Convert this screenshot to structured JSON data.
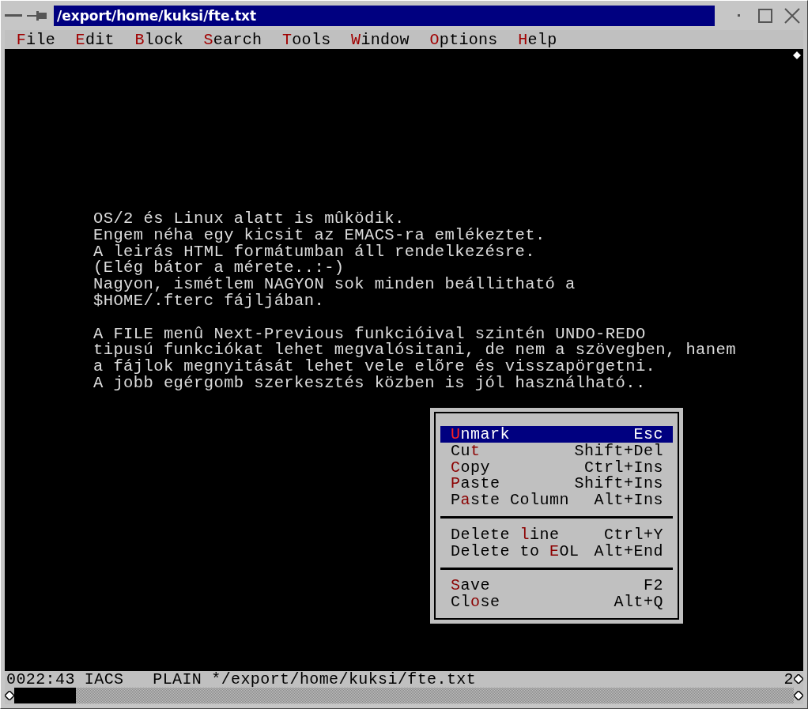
{
  "window": {
    "title": "/export/home/kuksi/fte.txt"
  },
  "menu_bar": [
    {
      "hotkey": "F",
      "after": "ile"
    },
    {
      "hotkey": "E",
      "after": "dit"
    },
    {
      "hotkey": "B",
      "after": "lock"
    },
    {
      "hotkey": "S",
      "after": "earch"
    },
    {
      "hotkey": "T",
      "after": "ools"
    },
    {
      "hotkey": "W",
      "after": "indow"
    },
    {
      "hotkey": "O",
      "after": "ptions"
    },
    {
      "hotkey": "H",
      "after": "elp"
    }
  ],
  "editor": {
    "paragraphs": [
      [
        "OS/2 és Linux alatt is mûködik.",
        "Engem néha egy kicsit az EMACS-ra emlékeztet.",
        "A leirás HTML formátumban áll rendelkezésre.",
        "(Elég bátor a mérete..:-)",
        "Nagyon, ismétlem NAGYON sok minden beállitható a",
        "$HOME/.fterc fájljában."
      ],
      [
        "A FILE menû Next-Previous funkcióival szintén UNDO-REDO",
        "tipusú funkciókat lehet megvalósitani, de nem a szövegben, hanem",
        "a fájlok megnyitását lehet vele elõre és visszapörgetni.",
        "A jobb egérgomb szerkesztés közben is jól használható.."
      ]
    ]
  },
  "context_menu": {
    "groups": [
      [
        {
          "hotkey": "U",
          "after": "nmark",
          "shortcut": "Esc",
          "selected": true
        },
        {
          "before": "Cu",
          "hotkey": "t",
          "shortcut": "Shift+Del",
          "selected": false
        },
        {
          "hotkey": "C",
          "after": "opy",
          "shortcut": "Ctrl+Ins",
          "selected": false
        },
        {
          "hotkey": "P",
          "after": "aste",
          "shortcut": "Shift+Ins",
          "selected": false
        },
        {
          "before": "P",
          "hotkey": "a",
          "after": "ste Column",
          "shortcut": "Alt+Ins",
          "selected": false
        }
      ],
      [
        {
          "before": "Delete ",
          "hotkey": "l",
          "after": "ine",
          "shortcut": "Ctrl+Y",
          "selected": false
        },
        {
          "before": "Delete to ",
          "hotkey": "E",
          "after": "OL",
          "shortcut": "Alt+End",
          "selected": false
        }
      ],
      [
        {
          "hotkey": "S",
          "after": "ave",
          "shortcut": "F2",
          "selected": false
        },
        {
          "before": "Cl",
          "hotkey": "o",
          "after": "se",
          "shortcut": "Alt+Q",
          "selected": false
        }
      ]
    ]
  },
  "status_bar": {
    "position": "0022:43",
    "mode": "IACS",
    "type": "PLAIN",
    "file": "*/export/home/kuksi/fte.txt",
    "window_number": "2"
  }
}
